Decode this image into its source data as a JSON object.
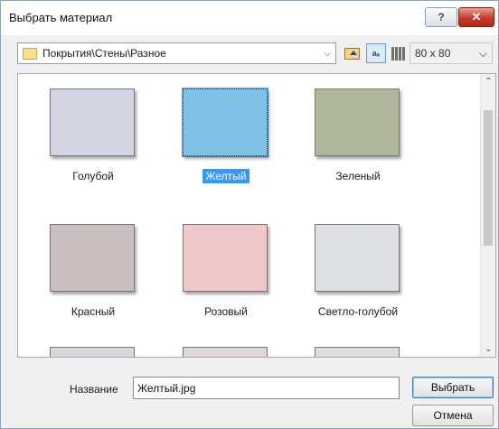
{
  "window": {
    "title": "Выбрать материал",
    "help_label": "?",
    "close_label": "✕"
  },
  "toolbar": {
    "path": "Покрытия\\Стены\\Разное",
    "path_dropdown_arrow": "⌵",
    "icons": [
      "folder-icon",
      "up-folder-icon",
      "sort-icon",
      "columns-icon"
    ],
    "sort_icon_text": "aₐ",
    "thumb_size": "80 x  80",
    "thumb_size_arrow": "⌵"
  },
  "gallery": {
    "items": [
      {
        "label": "Голубой",
        "color": "#d3d6e2",
        "selected": false
      },
      {
        "label": "Желтый",
        "color": "#7ec2e6",
        "selected": true
      },
      {
        "label": "Зеленый",
        "color": "#aeb79c",
        "selected": false
      },
      {
        "label": "Красный",
        "color": "#cbbebe",
        "selected": false
      },
      {
        "label": "Розовый",
        "color": "#f1c8c9",
        "selected": false
      },
      {
        "label": "Светло-голубой",
        "color": "#dde1e6",
        "selected": false
      }
    ],
    "partial_rows_colors": [
      "#d9d6dc",
      "#e0d8d8",
      "#dcdcdc"
    ],
    "scroll_up": "⌃",
    "scroll_down": "⌄"
  },
  "footer": {
    "name_label": "Название",
    "name_value": "Желтый.jpg",
    "select_label": "Выбрать",
    "cancel_label": "Отмена"
  },
  "colors": {
    "selection": "#3399ff",
    "close_button": "#c6392a"
  }
}
